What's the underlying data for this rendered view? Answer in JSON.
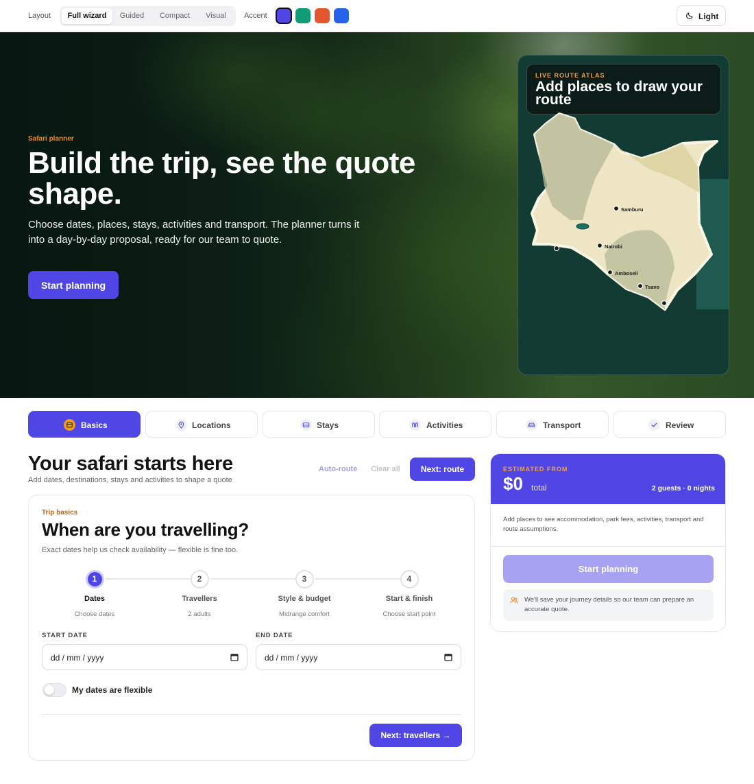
{
  "topbar": {
    "layout_label": "Layout",
    "layout_options": [
      "Full wizard",
      "Guided",
      "Compact",
      "Visual"
    ],
    "layout_selected": "Full wizard",
    "accent_label": "Accent",
    "accent_colors": [
      "#4f46e5",
      "#0f9d76",
      "#e4572e",
      "#2563eb"
    ],
    "theme_label": "Light",
    "theme_icon": "moon-icon"
  },
  "hero": {
    "eyebrow": "Safari planner",
    "title": "Build the trip, see the quote shape.",
    "subtitle": "Choose dates, places, stays, activities and transport. The planner turns it into a day-by-day proposal, ready for our team to quote.",
    "cta": "Start planning"
  },
  "atlas": {
    "eyebrow": "LIVE ROUTE ATLAS",
    "title": "Add places to draw your route",
    "places": [
      "Samburu",
      "Nairobi",
      "Amboseli",
      "Tsavo"
    ]
  },
  "tabs": [
    {
      "label": "Basics",
      "icon": "calendar-icon",
      "active": true
    },
    {
      "label": "Locations",
      "icon": "pin-icon",
      "active": false
    },
    {
      "label": "Stays",
      "icon": "bed-icon",
      "active": false
    },
    {
      "label": "Activities",
      "icon": "binoculars-icon",
      "active": false
    },
    {
      "label": "Transport",
      "icon": "car-icon",
      "active": false
    },
    {
      "label": "Review",
      "icon": "check-icon",
      "active": false
    }
  ],
  "main": {
    "title": "Your safari starts here",
    "subtitle": "Add dates, destinations, stays and activities to shape a quote",
    "auto_route": "Auto-route",
    "clear_all": "Clear all",
    "next_route": "Next: route"
  },
  "card": {
    "eyebrow": "Trip basics",
    "title": "When are you travelling?",
    "subtitle": "Exact dates help us check availability — flexible is fine too.",
    "steps": [
      {
        "num": "1",
        "title": "Dates",
        "sub": "Choose dates",
        "active": true
      },
      {
        "num": "2",
        "title": "Travellers",
        "sub": "2 adults",
        "active": false
      },
      {
        "num": "3",
        "title": "Style & budget",
        "sub": "Midrange comfort",
        "active": false
      },
      {
        "num": "4",
        "title": "Start & finish",
        "sub": "Choose start point",
        "active": false
      }
    ],
    "start_label": "START DATE",
    "end_label": "END DATE",
    "date_placeholder": "dd / mm / yyyy",
    "flexible_label": "My dates are flexible",
    "flexible_on": false,
    "next_travellers": "Next: travellers →"
  },
  "estimate": {
    "eyebrow": "ESTIMATED FROM",
    "amount": "$0",
    "total_label": "total",
    "meta": "2 guests · 0 nights",
    "note": "Add places to see accommodation, park fees, activities, transport and route assumptions.",
    "cta": "Start planning",
    "info": "We'll save your journey details so our team can prepare an accurate quote."
  }
}
